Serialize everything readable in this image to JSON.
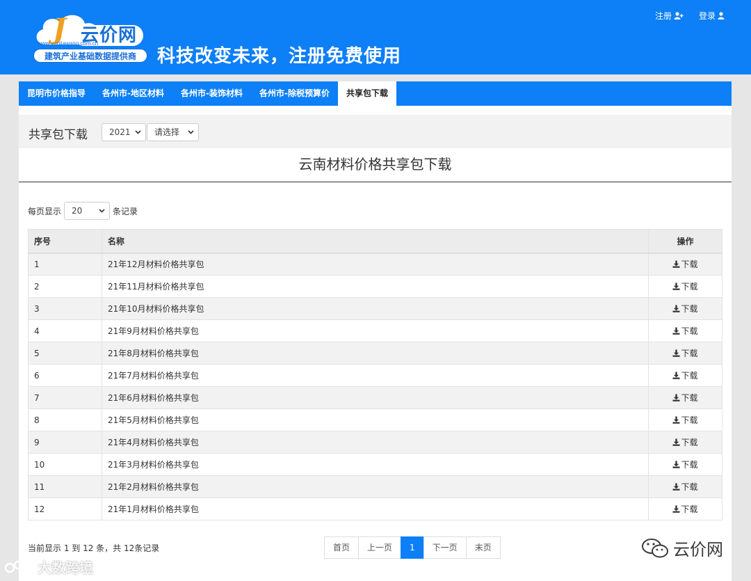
{
  "header": {
    "logo_letter": "J",
    "logo_name": "云价网",
    "logo_url": "www.yunjiawang.com.cn",
    "logo_tagline": "建筑产业基础数据提供商",
    "slogan": "科技改变未来，注册免费使用",
    "register_label": "注册",
    "login_label": "登录"
  },
  "tabs": [
    {
      "label": "昆明市价格指导",
      "active": false
    },
    {
      "label": "各州市-地区材料",
      "active": false
    },
    {
      "label": "各州市-装饰材料",
      "active": false
    },
    {
      "label": "各州市-除税预算价",
      "active": false
    },
    {
      "label": "共享包下载",
      "active": true
    }
  ],
  "filter": {
    "title": "共享包下载",
    "year": "2021",
    "choose": "请选择"
  },
  "page_heading": "云南材料价格共享包下载",
  "perpage": {
    "prefix": "每页显示",
    "value": "20",
    "suffix": "条记录"
  },
  "table": {
    "headers": [
      "序号",
      "名称",
      "操作"
    ],
    "download_label": "下载",
    "rows": [
      {
        "no": "1",
        "name": "21年12月材料价格共享包"
      },
      {
        "no": "2",
        "name": "21年11月材料价格共享包"
      },
      {
        "no": "3",
        "name": "21年10月材料价格共享包"
      },
      {
        "no": "4",
        "name": "21年9月材料价格共享包"
      },
      {
        "no": "5",
        "name": "21年8月材料价格共享包"
      },
      {
        "no": "6",
        "name": "21年7月材料价格共享包"
      },
      {
        "no": "7",
        "name": "21年6月材料价格共享包"
      },
      {
        "no": "8",
        "name": "21年5月材料价格共享包"
      },
      {
        "no": "9",
        "name": "21年4月材料价格共享包"
      },
      {
        "no": "10",
        "name": "21年3月材料价格共享包"
      },
      {
        "no": "11",
        "name": "21年2月材料价格共享包"
      },
      {
        "no": "12",
        "name": "21年1月材料价格共享包"
      }
    ]
  },
  "summary": "当前显示 1 到 12 条，共 12条记录",
  "pagination": {
    "first": "首页",
    "prev": "上一页",
    "current": "1",
    "next": "下一页",
    "last": "末页"
  },
  "watermark": {
    "right_text": "云价网",
    "left_text": "大数跨境"
  },
  "colors": {
    "brand": "#0d7ff7",
    "header_bg": "#0d7ff7"
  }
}
